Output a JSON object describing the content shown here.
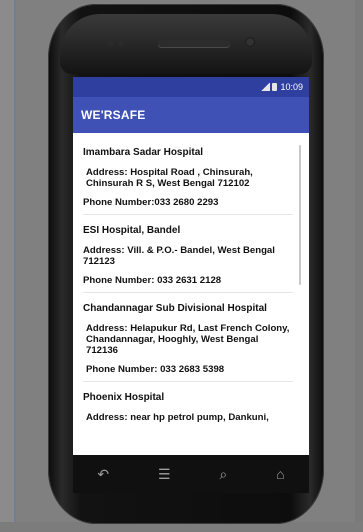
{
  "status": {
    "time": "10:09"
  },
  "app": {
    "title": "WE'RSAFE"
  },
  "hospitals": [
    {
      "name": "Imambara Sadar Hospital",
      "address": "Address: Hospital Road , Chinsurah, Chinsurah R S, West Bengal 712102",
      "phone": "Phone Number:033 2680 2293"
    },
    {
      "name": "ESI Hospital, Bandel",
      "address": "Address: Vill. & P.O.- Bandel, West Bengal 712123",
      "phone": "Phone Number: 033 2631 2128"
    },
    {
      "name": "Chandannagar Sub Divisional Hospital",
      "address": "Address: Helapukur Rd, Last French Colony, Chandannagar, Hooghly, West Bengal 712136",
      "phone": "Phone Number: 033 2683 5398"
    },
    {
      "name": "Phoenix Hospital",
      "address": "Address: near hp petrol pump, Dankuni,",
      "phone": ""
    }
  ],
  "nav": {
    "back_icon": "↶",
    "menu_icon": "☰",
    "search_icon": "⌕",
    "home_icon": "⌂"
  }
}
